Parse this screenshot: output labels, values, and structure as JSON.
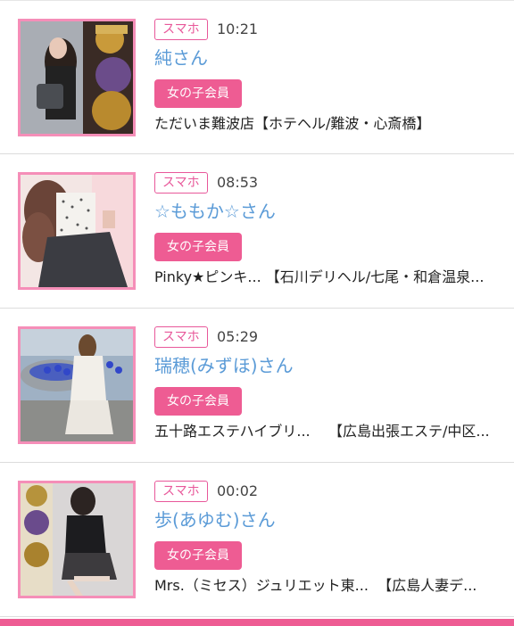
{
  "entries": [
    {
      "device": "スマホ",
      "time": "10:21",
      "name": "純さん",
      "member": "女の子会員",
      "shop_name": "ただいま難波店",
      "shop_area": "【ホテヘル/難波・心斎橋】"
    },
    {
      "device": "スマホ",
      "time": "08:53",
      "name": "☆ももか☆さん",
      "member": "女の子会員",
      "shop_name": "Pinky★ピンキ...",
      "shop_area": "【石川デリヘル/七尾・和倉温泉..."
    },
    {
      "device": "スマホ",
      "time": "05:29",
      "name": "瑞穂(みずほ)さん",
      "member": "女の子会員",
      "shop_name": "五十路エステハイブリ...",
      "shop_area": "【広島出張エステ/中区..."
    },
    {
      "device": "スマホ",
      "time": "00:02",
      "name": "歩(あゆむ)さん",
      "member": "女の子会員",
      "shop_name": "Mrs.（ミセス）ジュリエット東...",
      "shop_area": "【広島人妻デ..."
    }
  ],
  "colors": {
    "accent": "#ee5c93",
    "name_link": "#5b9bd7",
    "thumb_border": "#f58eb8"
  }
}
